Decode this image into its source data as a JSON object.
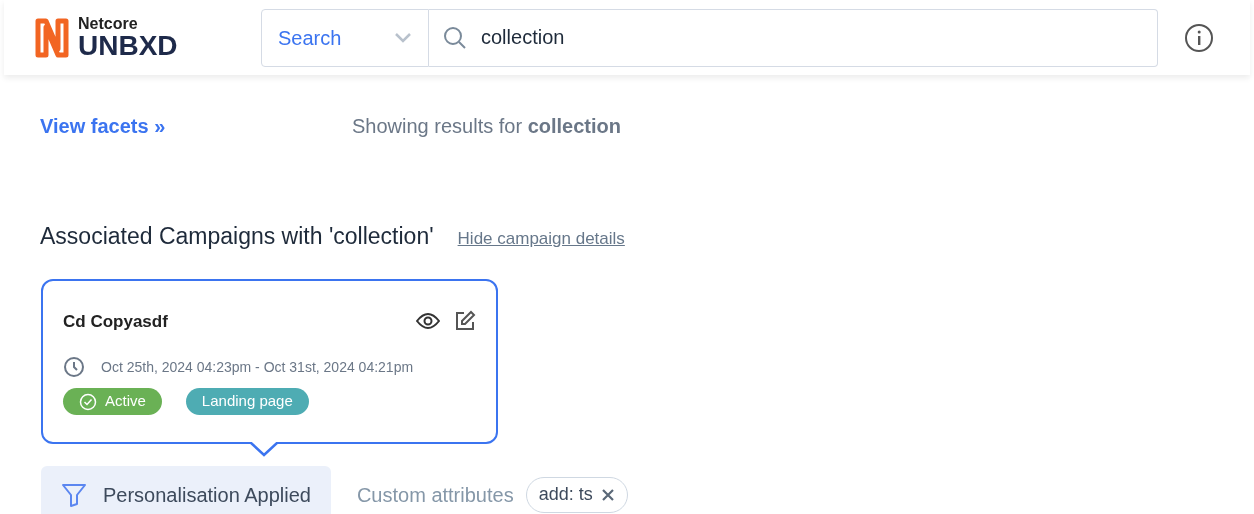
{
  "logo": {
    "top": "Netcore",
    "bottom": "UNBXD"
  },
  "search": {
    "scope": "Search",
    "value": "collection"
  },
  "view_facets": "View facets »",
  "results": "Showing results for **collection**",
  "campaigns": {
    "title": "Associated Campaigns with 'collection'",
    "toggle": "Hide campaign details",
    "cards": [
      {
        "name": "Cd Copyasdf",
        "dates": "Oct 25th, 2024 04:23pm - Oct 31st, 2024 04:21pm",
        "tags": [
          {
            "label": "Active",
            "kind": "status",
            "color": "#6ab155"
          },
          {
            "label": "Landing page",
            "kind": "type",
            "color": "#4eacb3"
          }
        ]
      }
    ]
  },
  "personalisation": {
    "label": "Personalisation Applied",
    "attributes_label": "Custom attributes",
    "attributes": [
      {
        "label": "add: ts"
      }
    ]
  }
}
